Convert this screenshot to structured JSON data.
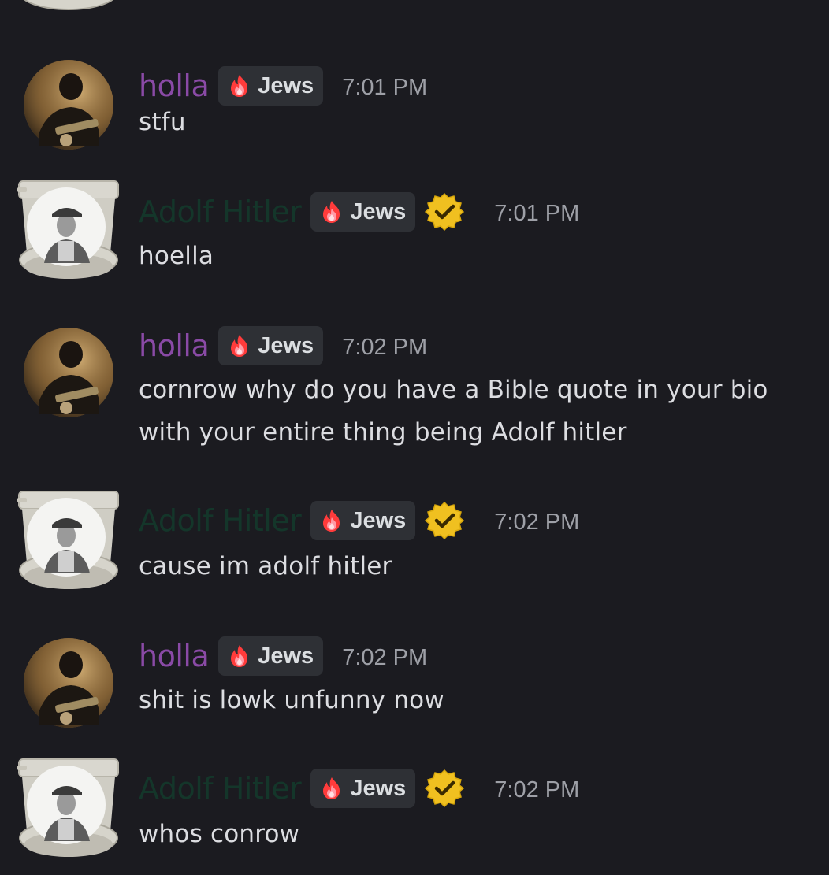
{
  "colors": {
    "background": "#1b1b20",
    "holla_name": "#8a4aa6",
    "adolf_name": "#14362a",
    "timestamp": "#9ea0a7",
    "message_text": "#dcdde1",
    "role_tag_bg": "#2e3035",
    "verified_badge": "#f0c020"
  },
  "icons": {
    "role": "flame-icon",
    "verified": "verified-badge-icon"
  },
  "messages": [
    {
      "author": "holla",
      "role": "Jews",
      "verified": false,
      "time": "7:01 PM",
      "text": "stfu"
    },
    {
      "author": "Adolf Hitler",
      "role": "Jews",
      "verified": true,
      "time": "7:01 PM",
      "text": "hoella"
    },
    {
      "author": "holla",
      "role": "Jews",
      "verified": false,
      "time": "7:02 PM",
      "text": "cornrow why do you have a Bible quote in your bio with your entire thing being Adolf hitler"
    },
    {
      "author": "Adolf Hitler",
      "role": "Jews",
      "verified": true,
      "time": "7:02 PM",
      "text": "cause im adolf hitler"
    },
    {
      "author": "holla",
      "role": "Jews",
      "verified": false,
      "time": "7:02 PM",
      "text": "shit is lowk unfunny now"
    },
    {
      "author": "Adolf Hitler",
      "role": "Jews",
      "verified": true,
      "time": "7:02 PM",
      "text": "whos conrow"
    }
  ]
}
